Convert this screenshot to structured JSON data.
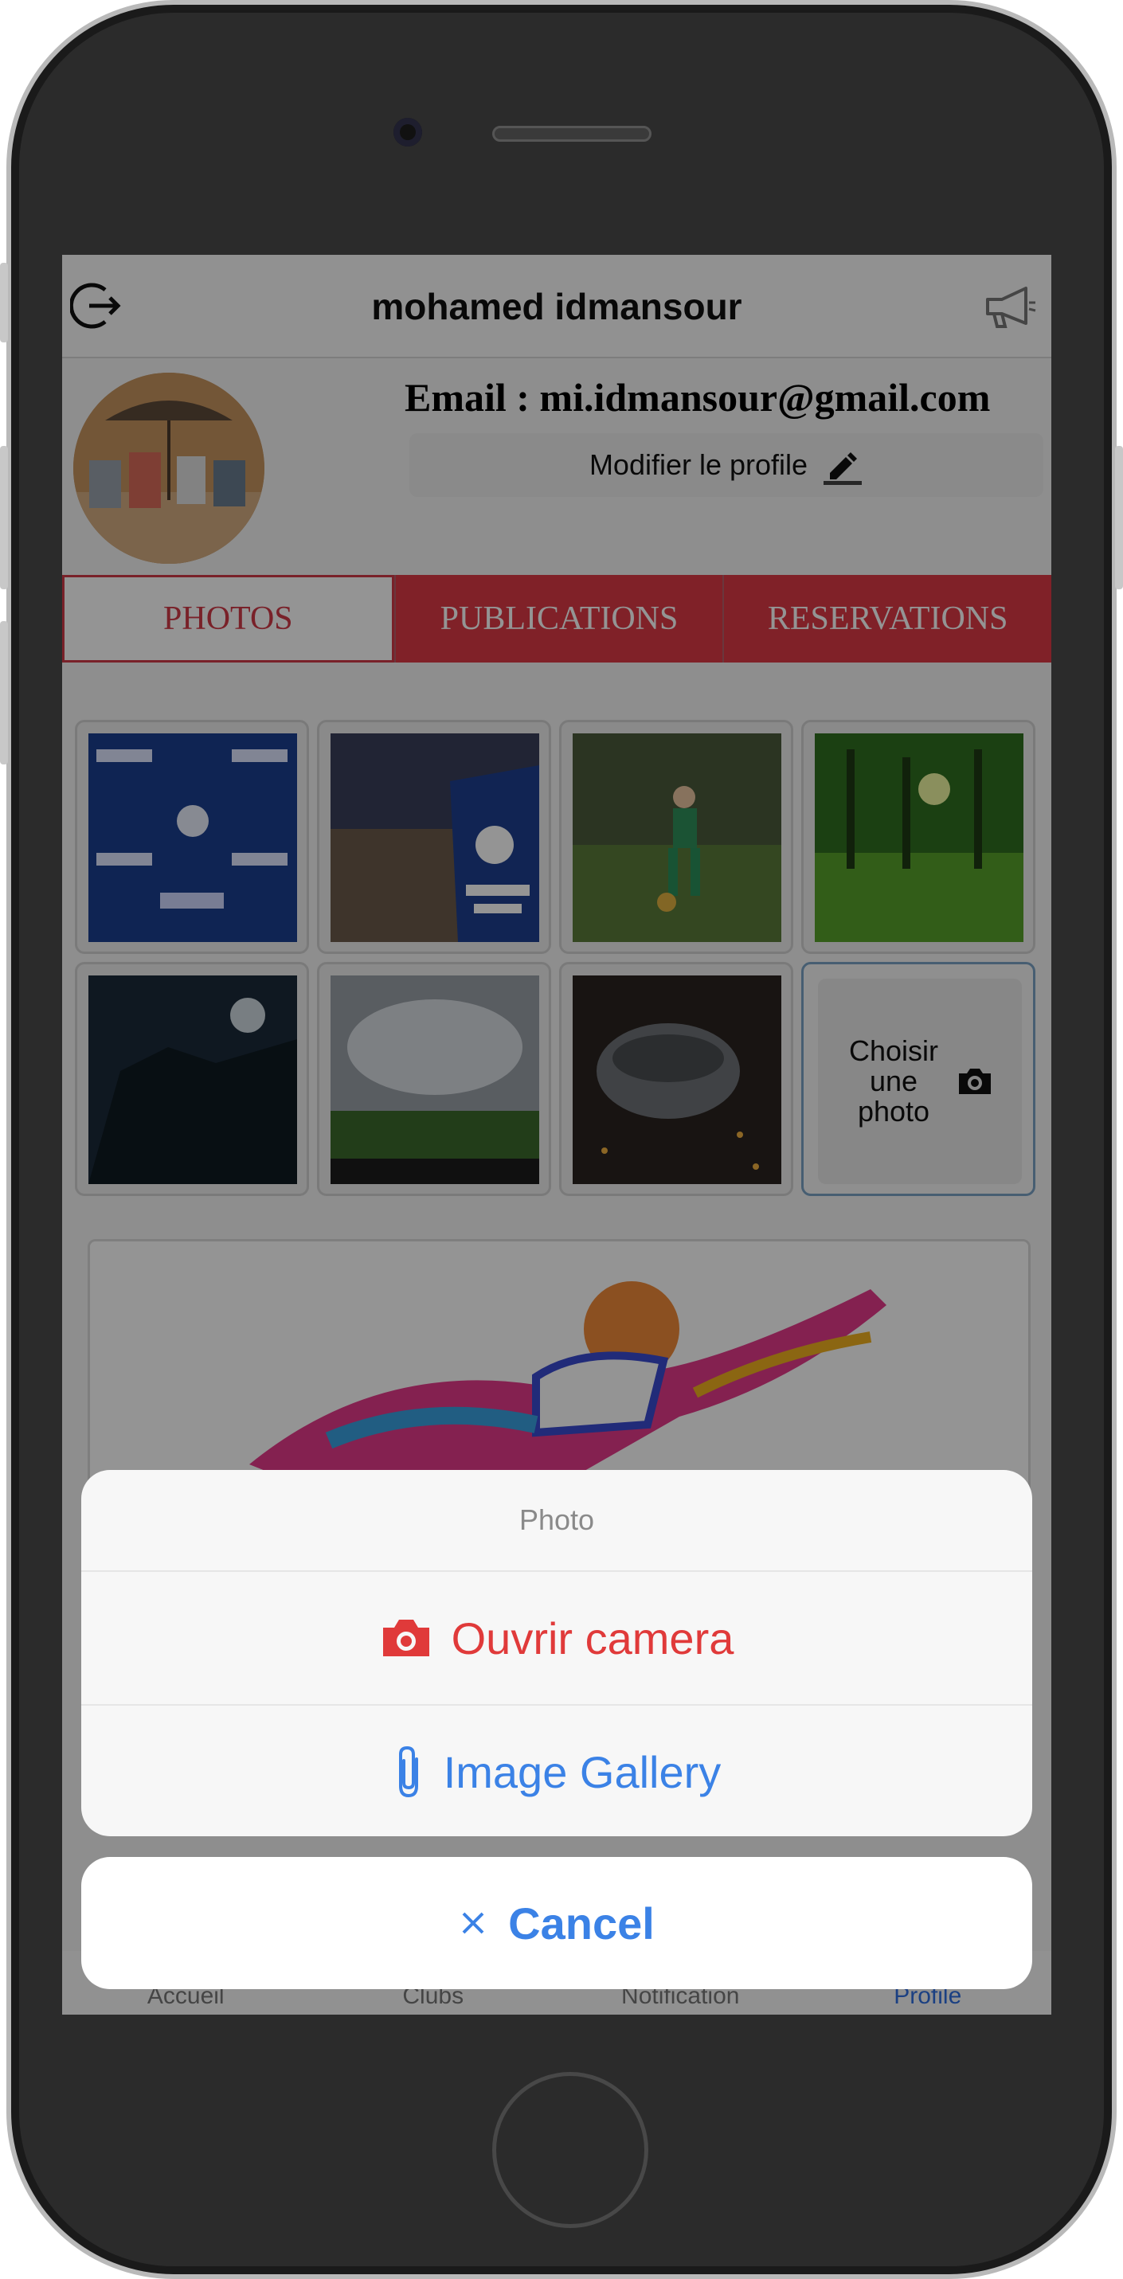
{
  "header": {
    "title": "mohamed idmansour"
  },
  "profile": {
    "email_line": "Email : mi.idmansour@gmail.com",
    "edit_button_label": "Modifier le profile"
  },
  "tabs": [
    {
      "label": "PHOTOS",
      "active": true
    },
    {
      "label": "PUBLICATIONS",
      "active": false
    },
    {
      "label": "RESERVATIONS",
      "active": false
    }
  ],
  "gallery": {
    "add_photo_label": "Choisir une photo"
  },
  "bottom_nav": [
    {
      "label": "Accueil"
    },
    {
      "label": "Clubs"
    },
    {
      "label": "Notification"
    },
    {
      "label": "Profile",
      "current": true
    }
  ],
  "action_sheet": {
    "title": "Photo",
    "camera_label": "Ouvrir camera",
    "gallery_label": "Image Gallery",
    "cancel_label": "Cancel"
  },
  "colors": {
    "accent_red": "#dd3946",
    "link_blue": "#3b82e6",
    "camera_red": "#e03a3a"
  }
}
